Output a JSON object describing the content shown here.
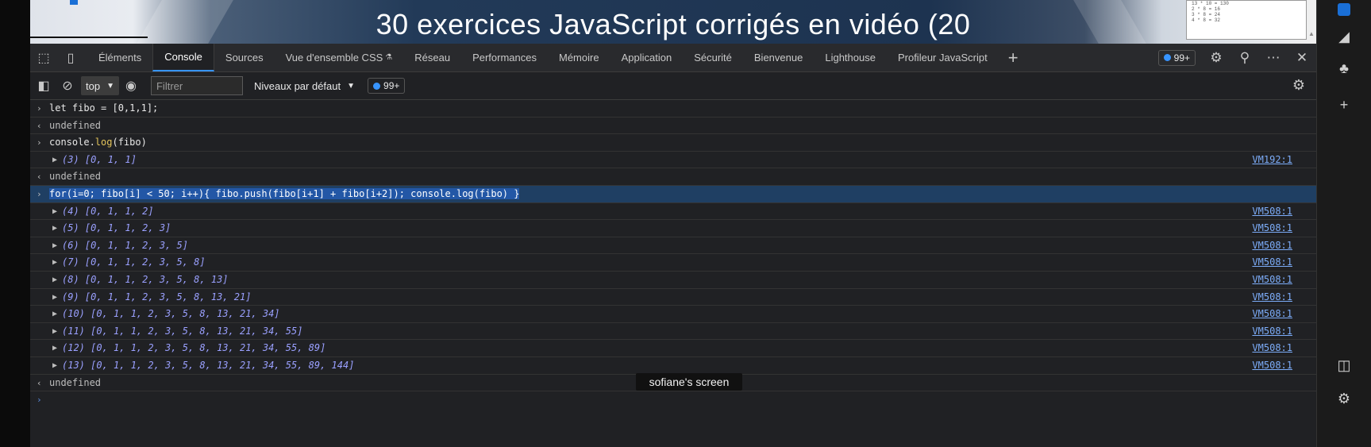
{
  "video": {
    "title": "30 exercices JavaScript corrigés en vidéo (20",
    "caption": "sofiane's screen"
  },
  "devtools": {
    "tabs": [
      {
        "label": "Éléments",
        "active": false
      },
      {
        "label": "Console",
        "active": true
      },
      {
        "label": "Sources",
        "active": false
      },
      {
        "label": "Vue d'ensemble CSS",
        "active": false,
        "lab": "⚗"
      },
      {
        "label": "Réseau",
        "active": false
      },
      {
        "label": "Performances",
        "active": false
      },
      {
        "label": "Mémoire",
        "active": false
      },
      {
        "label": "Application",
        "active": false
      },
      {
        "label": "Sécurité",
        "active": false
      },
      {
        "label": "Bienvenue",
        "active": false
      },
      {
        "label": "Lighthouse",
        "active": false
      },
      {
        "label": "Profileur JavaScript",
        "active": false
      }
    ],
    "issues_badge": "99+",
    "toolbar": {
      "context": "top",
      "filter_placeholder": "Filtrer",
      "levels": "Niveaux par défaut",
      "issues_badge": "99+"
    }
  },
  "console": {
    "input1": "let fibo = [0,1,1];",
    "undefined": "undefined",
    "input2_a": "console.",
    "input2_fn": "log",
    "input2_b": "(fibo)",
    "result0": "(3) [0, 1, 1]",
    "result0_src": "VM192:1",
    "loop_a": "for",
    "loop_b": "(i=0; fibo[i] < 50; i++){ fibo.",
    "loop_push": "push",
    "loop_c": "(fibo[i+1] + fibo[i+2]); console.",
    "loop_log": "log",
    "loop_d": "(fibo) }",
    "loop_src": "VM508:1",
    "results": [
      "(4) [0, 1, 1, 2]",
      "(5) [0, 1, 1, 2, 3]",
      "(6) [0, 1, 1, 2, 3, 5]",
      "(7) [0, 1, 1, 2, 3, 5, 8]",
      "(8) [0, 1, 1, 2, 3, 5, 8, 13]",
      "(9) [0, 1, 1, 2, 3, 5, 8, 13, 21]",
      "(10) [0, 1, 1, 2, 3, 5, 8, 13, 21, 34]",
      "(11) [0, 1, 1, 2, 3, 5, 8, 13, 21, 34, 55]",
      "(12) [0, 1, 1, 2, 3, 5, 8, 13, 21, 34, 55, 89]",
      "(13) [0, 1, 1, 2, 3, 5, 8, 13, 21, 34, 55, 89, 144]"
    ]
  }
}
